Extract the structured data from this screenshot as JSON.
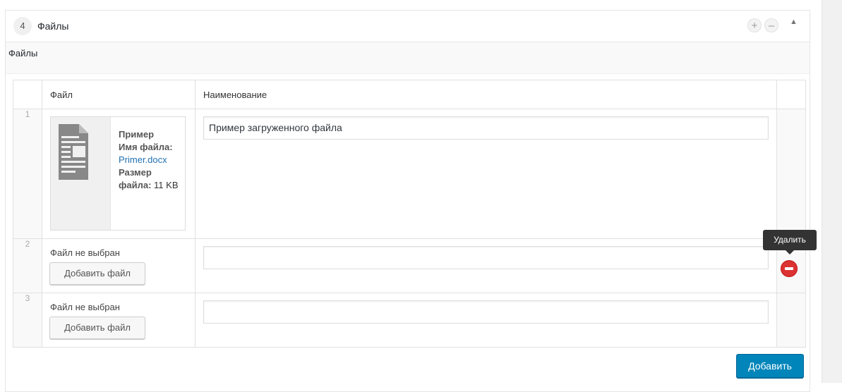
{
  "panel": {
    "number": "4",
    "title": "Файлы",
    "controls": {
      "add": "+",
      "remove": "–",
      "collapse": "▲"
    }
  },
  "section": {
    "title": "Файлы"
  },
  "table": {
    "columns": [
      "Файл",
      "Наименование"
    ],
    "rows": [
      {
        "index": "1",
        "file": {
          "title": "Пример",
          "name_label": "Имя файла:",
          "name_value": "Primer.docx",
          "size_label": "Размер файла:",
          "size_value": "11 KB"
        },
        "name_value": "Пример загруженного файла"
      },
      {
        "index": "2",
        "no_file_text": "Файл не выбран",
        "add_file_label": "Добавить файл",
        "name_value": ""
      },
      {
        "index": "3",
        "no_file_text": "Файл не выбран",
        "add_file_label": "Добавить файл",
        "name_value": ""
      }
    ]
  },
  "row_actions": {
    "remove_tooltip": "Удалить",
    "remove_icon": "minus-circle-icon"
  },
  "footer": {
    "add_button": "Добавить"
  },
  "colors": {
    "primary": "#0085ba",
    "danger": "#dc3232",
    "tooltip": "#333333"
  }
}
